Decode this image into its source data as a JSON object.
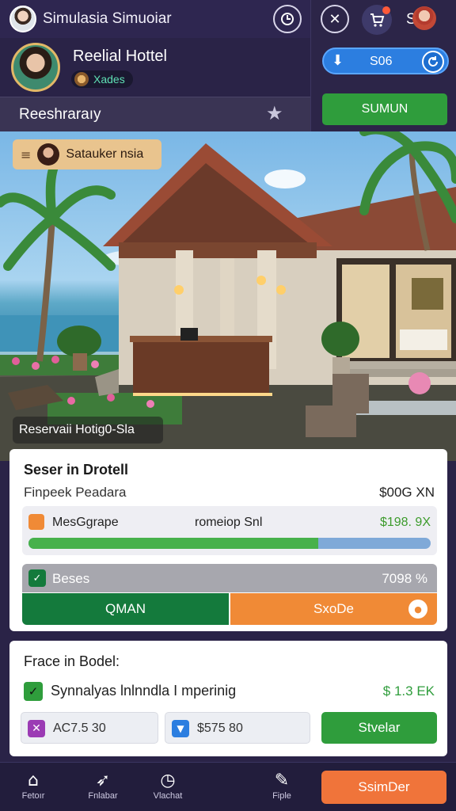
{
  "header": {
    "title": "Simulasia Simuoiar",
    "right_label": "S6F"
  },
  "profile": {
    "name": "Reelial Hottel",
    "badge": "Xades"
  },
  "subheader": {
    "label": "Reeshraraıy"
  },
  "top_right": {
    "counter_value": "S06",
    "submit_label": "SUMUN"
  },
  "hero": {
    "host_chip_label": "Satauker nsia",
    "caption": "Reservaii Hotig0-Sla"
  },
  "booking_card": {
    "title": "Seser in Drotell",
    "subtitle": "Finpeek Peadara",
    "price": "$00G XN",
    "row1": {
      "label": "MesGgrape",
      "center": "romeiop Snl",
      "value": "$198. 9X",
      "progress": 0.72
    },
    "row2": {
      "label": "Beses",
      "value": "7098 %"
    },
    "primary_label": "QMAN",
    "secondary_label": "SxoDe"
  },
  "price_card": {
    "title": "Frace in Bodel:",
    "check_label": "Synnalyas lnlnndla I mperinig",
    "check_value": "$ 1.3 EK",
    "field1": "AC7.5 30",
    "field2": "$575 80",
    "action_label": "Stvelar"
  },
  "nav": {
    "items": [
      {
        "label": "Fetoır"
      },
      {
        "label": "Fnlabar"
      },
      {
        "label": "Vlachat"
      },
      {
        "label": "Fiple"
      }
    ],
    "cta_label": "SsimDer"
  },
  "colors": {
    "background": "#2a2347",
    "green": "#2f9d3c",
    "dark_green": "#147a3c",
    "orange": "#f08a36",
    "blue": "#2c7ee0",
    "cta": "#f0743a"
  }
}
